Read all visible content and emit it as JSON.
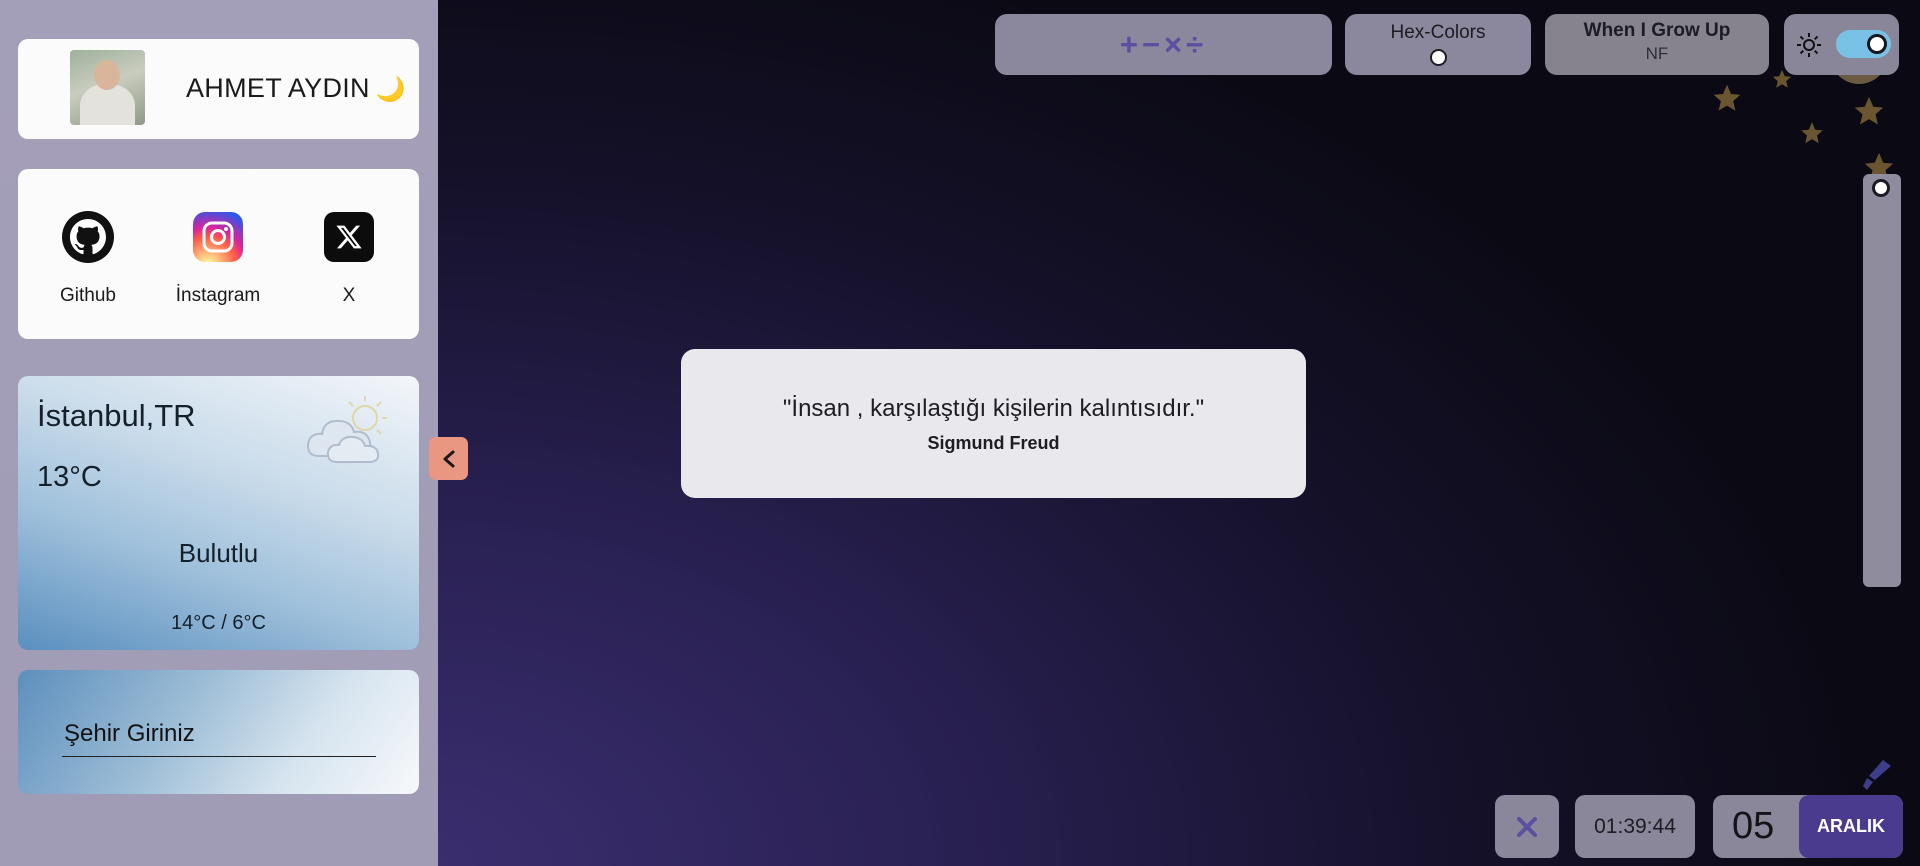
{
  "profile": {
    "name": "AHMET AYDIN",
    "emoji": "🌙"
  },
  "social": {
    "items": [
      {
        "label": "Github",
        "icon": "github-icon"
      },
      {
        "label": "İnstagram",
        "icon": "instagram-icon"
      },
      {
        "label": "X",
        "icon": "x-icon"
      }
    ]
  },
  "weather": {
    "city": "İstanbul,TR",
    "temperature": "13°C",
    "condition": "Bulutlu",
    "range": "14°C / 6°C",
    "icon": "cloud-sun-icon"
  },
  "city_input": {
    "placeholder": "Şehir Giriniz"
  },
  "toolbar": {
    "math_label": "+−×÷",
    "hex": {
      "label": "Hex-Colors"
    },
    "grow": {
      "title": "When I Grow Up",
      "subtitle": "NF"
    },
    "theme": {
      "mode": "dark",
      "toggle_on": true
    }
  },
  "quote": {
    "text": "\"İnsan , karşılaştığı kişilerin kalıntısıdır.\"",
    "author": "Sigmund Freud"
  },
  "bottom": {
    "time": "01:39:44",
    "day": "05",
    "month": "ARALIK"
  },
  "colors": {
    "accent_purple": "#4a3b8f",
    "collapse_button": "#e99683",
    "toggle_track": "#79c2e6"
  }
}
